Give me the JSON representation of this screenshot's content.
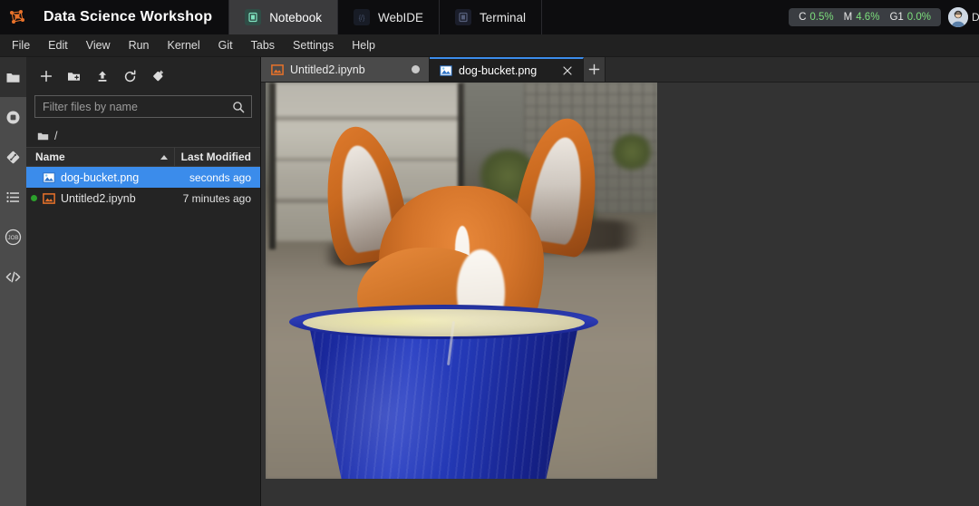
{
  "topbar": {
    "logo_icon": "orange-network-logo",
    "title": "Data Science Workshop",
    "workspace_tabs": [
      {
        "label": "Notebook",
        "icon": "notebook-icon",
        "active": true
      },
      {
        "label": "WebIDE",
        "icon": "code-braces-icon",
        "active": false
      },
      {
        "label": "Terminal",
        "icon": "terminal-icon",
        "active": false
      }
    ],
    "resource_monitor": [
      {
        "label": "C",
        "value": "0.5%"
      },
      {
        "label": "M",
        "value": "4.6%"
      },
      {
        "label": "G1",
        "value": "0.0%"
      }
    ],
    "avatar_icon": "user-avatar",
    "user_label": "D",
    "accent_green": "#7ddf7d",
    "active_tab_bg": "#3b3b3d"
  },
  "menubar": {
    "items": [
      "File",
      "Edit",
      "View",
      "Run",
      "Kernel",
      "Git",
      "Tabs",
      "Settings",
      "Help"
    ]
  },
  "rail": {
    "items": [
      {
        "name": "file-browser",
        "icon": "folder-icon",
        "active": true
      },
      {
        "name": "running-sessions",
        "icon": "stop-circle-icon",
        "active": false
      },
      {
        "name": "git-panel",
        "icon": "git-diamond-icon",
        "active": false
      },
      {
        "name": "table-of-contents",
        "icon": "list-icon",
        "active": false
      },
      {
        "name": "jobs-panel",
        "icon": "job-badge-icon",
        "active": false
      },
      {
        "name": "extensions",
        "icon": "code-angle-brackets-icon",
        "active": false
      }
    ]
  },
  "filebrowser": {
    "toolbar": [
      {
        "name": "new-launcher",
        "icon": "plus-icon"
      },
      {
        "name": "new-folder",
        "icon": "new-folder-icon"
      },
      {
        "name": "upload-files",
        "icon": "upload-icon"
      },
      {
        "name": "refresh-file-list",
        "icon": "refresh-icon"
      },
      {
        "name": "git-clone",
        "icon": "git-clone-icon"
      }
    ],
    "filter": {
      "placeholder": "Filter files by name",
      "value": "",
      "icon": "search-icon"
    },
    "breadcrumb": {
      "icon": "folder-icon",
      "path": "/"
    },
    "columns": {
      "name": "Name",
      "last_modified": "Last Modified",
      "sort": "ascending"
    },
    "files": [
      {
        "name": "dog-bucket.png",
        "modified": "seconds ago",
        "type": "image",
        "selected": true,
        "running": false
      },
      {
        "name": "Untitled2.ipynb",
        "modified": "7 minutes ago",
        "type": "notebook",
        "selected": false,
        "running": true
      }
    ],
    "selection_color": "#3b8ceb",
    "running_color": "#2ca02c"
  },
  "dock": {
    "tabs": [
      {
        "label": "Untitled2.ipynb",
        "type": "notebook",
        "active": false,
        "dirty": true
      },
      {
        "label": "dog-bucket.png",
        "type": "image",
        "active": true,
        "dirty": false,
        "close_icon": "close-icon"
      }
    ],
    "add_tab_icon": "plus-icon",
    "active_tab_accent": "#3b8ceb"
  },
  "viewer": {
    "name": "image-viewer",
    "file": "dog-bucket.png",
    "alt": "A corgi puppy sitting inside a blue bucket on gravel ground in front of a concrete wall",
    "background": "#333333",
    "colors": {
      "bucket_blue": "#1d2ea8",
      "bucket_interior": "#ded8b4",
      "dog_fur": "#d4742a",
      "dog_white": "#f7f3ec",
      "ground": "#8a8275",
      "wall": "#b9b6ad"
    }
  }
}
